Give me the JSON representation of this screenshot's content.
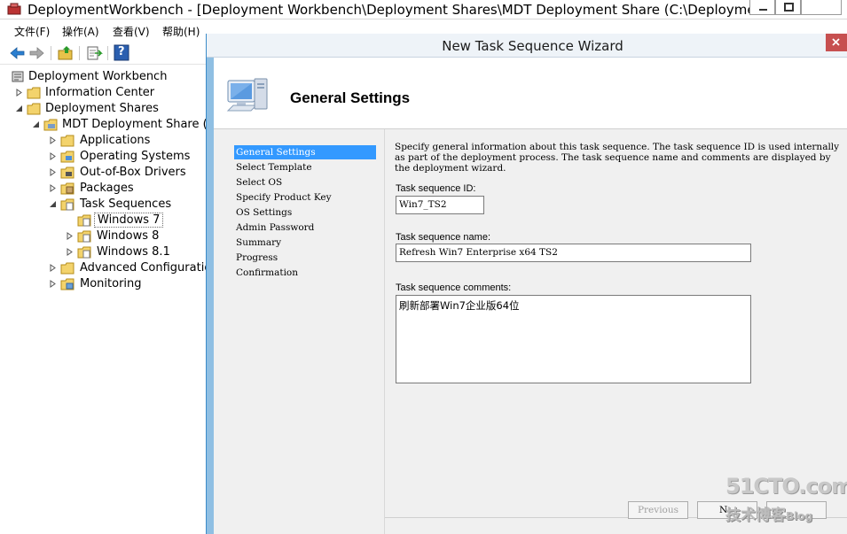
{
  "window": {
    "title": "DeploymentWorkbench - [Deployment Workbench\\Deployment Shares\\MDT Deployment Share (C:\\Deployment..."
  },
  "menu": {
    "file": "文件(F)",
    "action": "操作(A)",
    "view": "查看(V)",
    "help": "帮助(H)"
  },
  "toolbar": {
    "icons": [
      "back-arrow-icon",
      "forward-arrow-icon",
      "up-folder-icon",
      "export-list-icon",
      "help-icon"
    ],
    "help_glyph": "?"
  },
  "tree": {
    "root": "Deployment Workbench",
    "information_center": "Information Center",
    "deployment_shares": "Deployment Shares",
    "mdt_share": "MDT Deployment Share (C:\\",
    "applications": "Applications",
    "operating_systems": "Operating Systems",
    "drivers": "Out-of-Box Drivers",
    "packages": "Packages",
    "task_sequences": "Task Sequences",
    "windows7": "Windows 7",
    "windows8": "Windows 8",
    "windows81": "Windows 8.1",
    "advanced": "Advanced Configuration",
    "monitoring": "Monitoring"
  },
  "wizard": {
    "title": "New Task Sequence Wizard",
    "heading": "General Settings",
    "nav": [
      "General Settings",
      "Select Template",
      "Select OS",
      "Specify Product Key",
      "OS Settings",
      "Admin Password",
      "Summary",
      "Progress",
      "Confirmation"
    ],
    "active_step": "General Settings",
    "description": "Specify general information about this task sequence.  The task sequence ID is used internally as part of the deployment process.  The task sequence name and comments are displayed by the deployment wizard.",
    "id_label": "Task sequence ID:",
    "id_value": "Win7_TS2",
    "name_label": "Task sequence name:",
    "name_value": "Refresh Win7 Enterprise x64 TS2",
    "comments_label": "Task sequence comments:",
    "comments_value": "刷新部署Win7企业版64位",
    "previous_button": "Previous",
    "next_button_partial": "N"
  },
  "watermark": {
    "line1": "51CTO.com",
    "line2": "技术博客",
    "line2_suffix": "Blog"
  },
  "colors": {
    "selection": "#3399ff",
    "frame": "#8fbfe3",
    "close_red": "#c75050"
  }
}
